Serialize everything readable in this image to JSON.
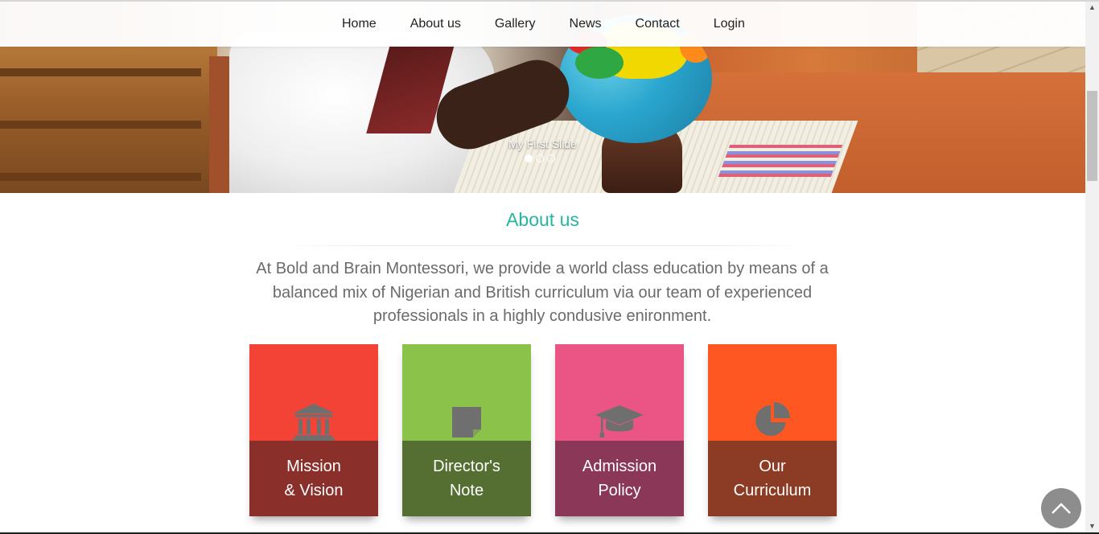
{
  "nav": {
    "items": [
      {
        "label": "Home"
      },
      {
        "label": "About us"
      },
      {
        "label": "Gallery"
      },
      {
        "label": "News"
      },
      {
        "label": "Contact"
      },
      {
        "label": "Login"
      }
    ]
  },
  "hero": {
    "caption": "My First Slide",
    "slide_count": 3,
    "active_slide": 1
  },
  "about": {
    "title": "About us",
    "text": "At Bold and Brain Montessori, we provide a world class education by means of a balanced mix of Nigerian and British curriculum via our team of experienced professionals in a highly condusive enironment."
  },
  "cards": [
    {
      "line1": "Mission",
      "line2": "& Vision",
      "icon": "building-icon",
      "top_color": "#f34336",
      "bottom_color": "#8a2f29"
    },
    {
      "line1": "Director's",
      "line2": "Note",
      "icon": "note-icon",
      "top_color": "#8bc34a",
      "bottom_color": "#556e31"
    },
    {
      "line1": "Admission",
      "line2": "Policy",
      "icon": "graduation-cap-icon",
      "top_color": "#eb5586",
      "bottom_color": "#8a3758"
    },
    {
      "line1": "Our",
      "line2": "Curriculum",
      "icon": "pie-chart-icon",
      "top_color": "#fe5722",
      "bottom_color": "#8c3b24"
    }
  ],
  "colors": {
    "accent": "#26b5a0",
    "icon_gray": "#6f6f6f",
    "back_to_top": "#8d8d8d"
  }
}
